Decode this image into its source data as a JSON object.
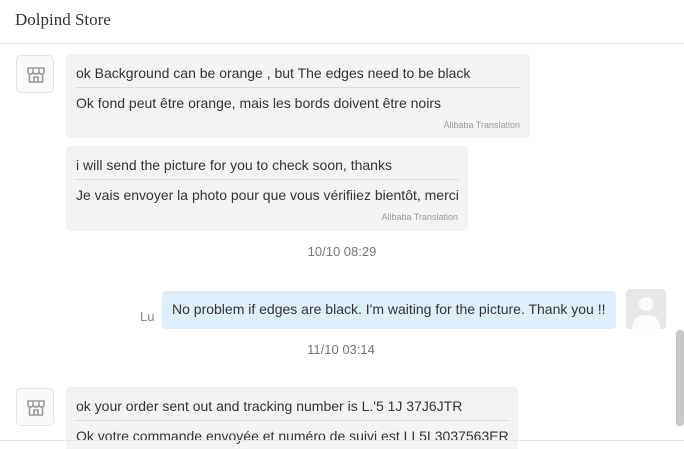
{
  "header": {
    "title": "Dolpind Store"
  },
  "messages": [
    {
      "original": "ok          Background can be orange   ,  but  The edges need to be black",
      "translation": "Ok fond peut être orange, mais les bords doivent être noirs",
      "source": "Alibaba Translation"
    },
    {
      "original": "i will send the picture for you to check soon, thanks",
      "translation": "Je vais envoyer la photo pour que vous vérifiiez bientôt, merci",
      "source": "Alibaba Translation"
    },
    {
      "original": "ok your order sent out and tracking number is   L.'5 1J 37J6JTR",
      "translation": "Ok votre commande envoyée et numéro de suivi est LI 5L3037563ER"
    }
  ],
  "timestamps": [
    "10/10 08:29",
    "11/10 03:14"
  ],
  "outgoing": {
    "sender": "Lu",
    "text": "No problem if edges are black. I'm waiting for the picture. Thank you !!"
  }
}
